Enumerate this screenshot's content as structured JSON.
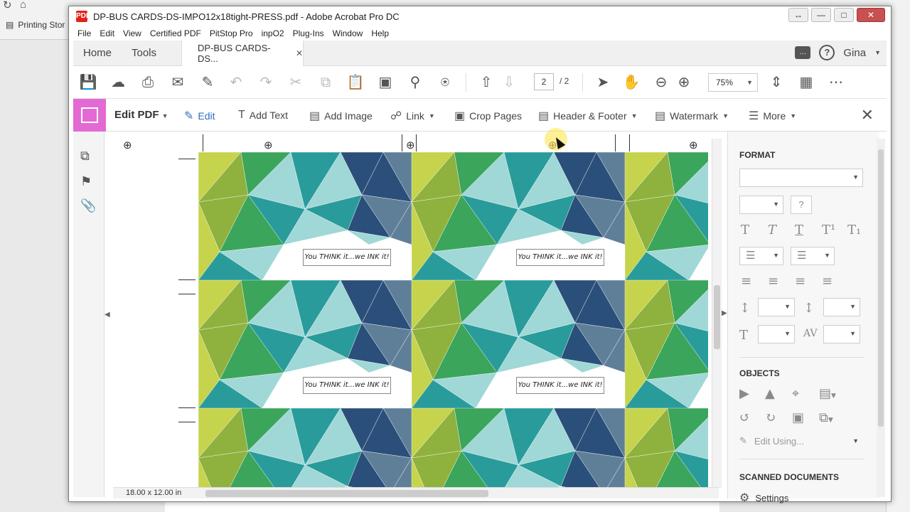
{
  "browser": {
    "bookmark": "Printing Stor",
    "status_icon": "lock-icon"
  },
  "window": {
    "title": "DP-BUS CARDS-DS-IMPO12x18tight-PRESS.pdf - Adobe Acrobat Pro DC",
    "app_icon": "PDF"
  },
  "menu": [
    "File",
    "Edit",
    "View",
    "Certified PDF",
    "PitStop Pro",
    "inpO2",
    "Plug-Ins",
    "Window",
    "Help"
  ],
  "tabs": {
    "home": "Home",
    "tools": "Tools",
    "document": "DP-BUS CARDS-DS...",
    "user": "Gina"
  },
  "toolbar": {
    "page_current": "2",
    "page_total": "/ 2",
    "zoom": "75%"
  },
  "edit_pdf": {
    "title": "Edit PDF",
    "tools": [
      "Edit",
      "Add Text",
      "Add Image",
      "Link",
      "Crop Pages",
      "Header & Footer",
      "Watermark",
      "More"
    ]
  },
  "document": {
    "card_slogan": "You THINK it...we INK it!",
    "page_size": "18.00 x 12.00 in",
    "colors": {
      "lime": "#c6d34d",
      "olive": "#8fb13e",
      "green": "#3aa55b",
      "teal": "#2a9b9b",
      "aqua": "#9fd8d6",
      "navy": "#2a4f7a",
      "slate": "#5f7f99"
    }
  },
  "right_panel": {
    "format_heading": "FORMAT",
    "objects_heading": "OBJECTS",
    "edit_using": "Edit Using...",
    "scanned_heading": "SCANNED DOCUMENTS",
    "settings": "Settings"
  }
}
